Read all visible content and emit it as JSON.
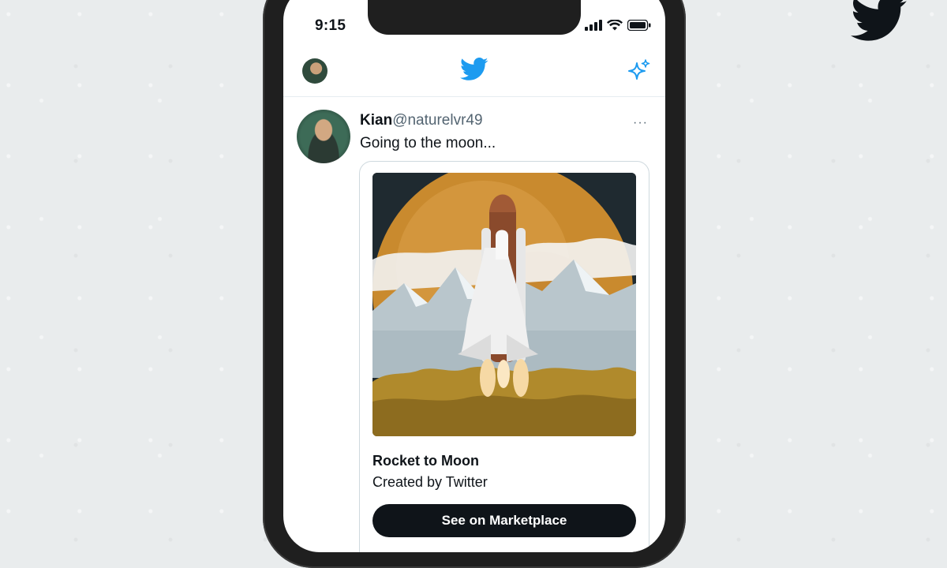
{
  "status_bar": {
    "time": "9:15"
  },
  "colors": {
    "accent": "#1d9bf0",
    "text": "#0f1419",
    "muted": "#536471",
    "button": "#0f1419"
  },
  "icons": {
    "corner": "twitter-bird-icon",
    "header_logo": "twitter-bird-icon",
    "header_right": "sparkle-icon",
    "status": [
      "signal-icon",
      "wifi-icon",
      "battery-icon"
    ],
    "tweet_menu": "more-icon"
  },
  "tweet": {
    "name": "Kian",
    "handle": "@naturelvr49",
    "more_label": "···",
    "text": "Going to the moon...",
    "card": {
      "title": "Rocket to Moon",
      "creator": "Created by Twitter",
      "button_label": "See on Marketplace"
    }
  }
}
